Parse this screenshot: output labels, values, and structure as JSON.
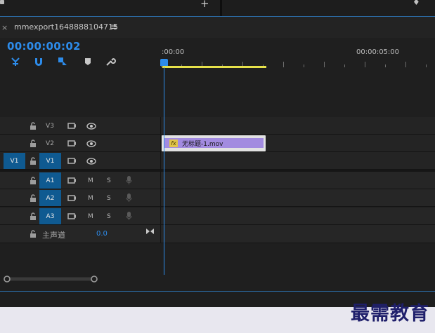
{
  "panel": {
    "close_icon": "×",
    "sequence_name": "mmexport1648888104715",
    "menu_icon": "≡",
    "timecode": "00:00:00:02"
  },
  "toolbar": {
    "icons": [
      "snap-ripple-icon",
      "magnet-icon",
      "linked-selection-icon",
      "marker-icon",
      "wrench-icon"
    ]
  },
  "ruler": {
    "start_label": ":00:00",
    "end_label": "00:00:05:00"
  },
  "tracks": {
    "video": [
      {
        "name": "V3",
        "targeted": false,
        "source_patch": ""
      },
      {
        "name": "V2",
        "targeted": false,
        "source_patch": ""
      },
      {
        "name": "V1",
        "targeted": true,
        "source_patch": "V1"
      }
    ],
    "audio": [
      {
        "name": "A1",
        "mute": "M",
        "solo": "S"
      },
      {
        "name": "A2",
        "mute": "M",
        "solo": "S"
      },
      {
        "name": "A3",
        "mute": "M",
        "solo": "S"
      }
    ],
    "master": {
      "label": "主声道",
      "value": "0.0"
    }
  },
  "clip": {
    "fx_label": "fx",
    "name": "无标题-1.mov"
  },
  "colors": {
    "accent": "#2d8ceb",
    "target": "#0f5a91",
    "clip": "#a28be0",
    "workbar": "#e6e14a"
  },
  "watermark": "最需教育"
}
